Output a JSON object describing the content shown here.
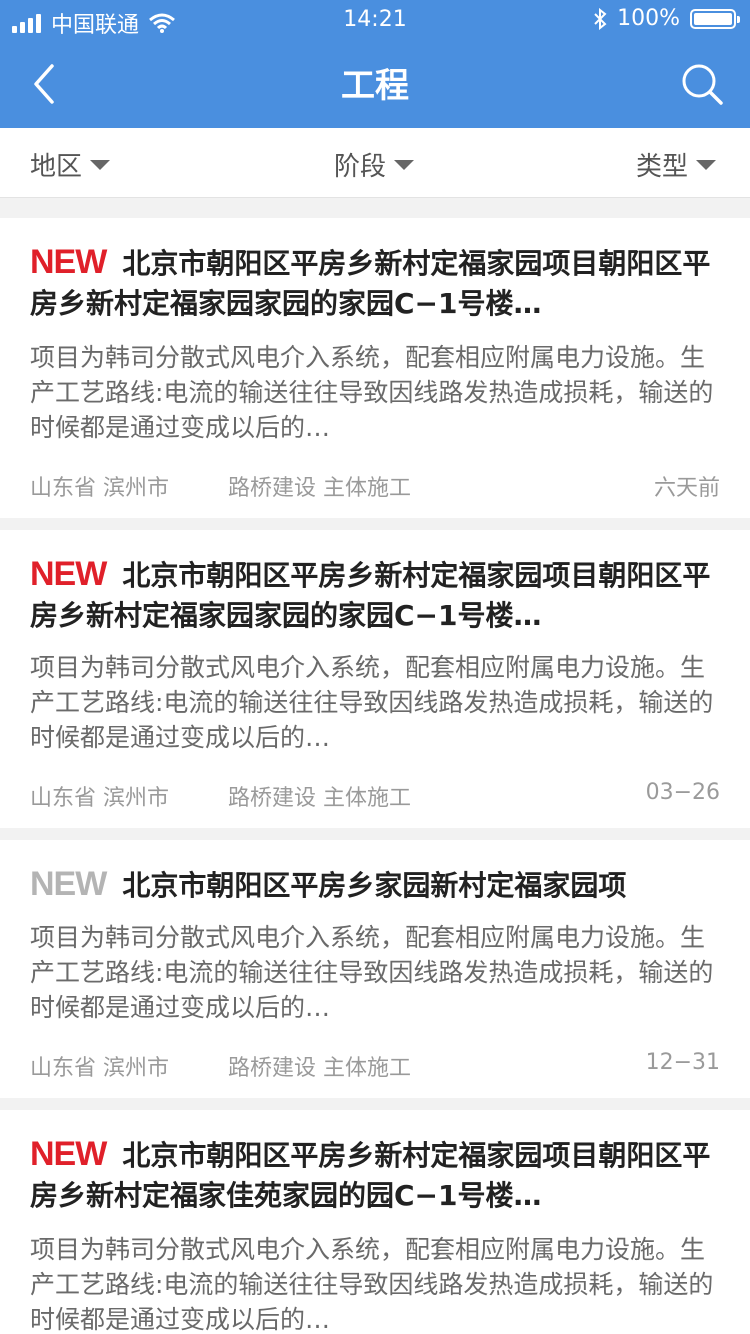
{
  "status": {
    "carrier": "中国联通",
    "time": "14:21",
    "battery": "100%"
  },
  "nav": {
    "title": "工程",
    "back_icon": "back-icon",
    "search_icon": "search-icon"
  },
  "filters": [
    {
      "label": "地区"
    },
    {
      "label": "阶段"
    },
    {
      "label": "类型"
    }
  ],
  "colors": {
    "primary": "#4a8fdf",
    "new_red": "#e0202a",
    "new_gray": "#b4b4b4"
  },
  "items": [
    {
      "badge": "NEW",
      "title": "北京市朝阳区平房乡新村定福家园项目朝阳区平房乡新村定福家园家园的家园C−1号楼…",
      "desc": "项目为韩司分散式风电介入系统，配套相应附属电力设施。生产工艺路线:电流的输送往往导致因线路发热造成损耗，输送的时候都是通过变成以后的…",
      "region": "山东省  滨州市",
      "tags": "路桥建设  主体施工",
      "time": "六天前"
    },
    {
      "badge": "NEW",
      "title": "北京市朝阳区平房乡新村定福家园项目朝阳区平房乡新村定福家园家园的家园C−1号楼…",
      "desc": "项目为韩司分散式风电介入系统，配套相应附属电力设施。生产工艺路线:电流的输送往往导致因线路发热造成损耗，输送的时候都是通过变成以后的…",
      "region": "山东省  滨州市",
      "tags": "路桥建设  主体施工",
      "time": "03−26"
    },
    {
      "badge": "NEW",
      "title": "北京市朝阳区平房乡家园新村定福家园项",
      "desc": "项目为韩司分散式风电介入系统，配套相应附属电力设施。生产工艺路线:电流的输送往往导致因线路发热造成损耗，输送的时候都是通过变成以后的…",
      "region": "山东省  滨州市",
      "tags": "路桥建设  主体施工",
      "time": "12−31"
    },
    {
      "badge": "NEW",
      "title": "北京市朝阳区平房乡新村定福家园项目朝阳区平房乡新村定福家佳苑家园的园C−1号楼…",
      "desc": "项目为韩司分散式风电介入系统，配套相应附属电力设施。生产工艺路线:电流的输送往往导致因线路发热造成损耗，输送的时候都是通过变成以后的…"
    }
  ]
}
